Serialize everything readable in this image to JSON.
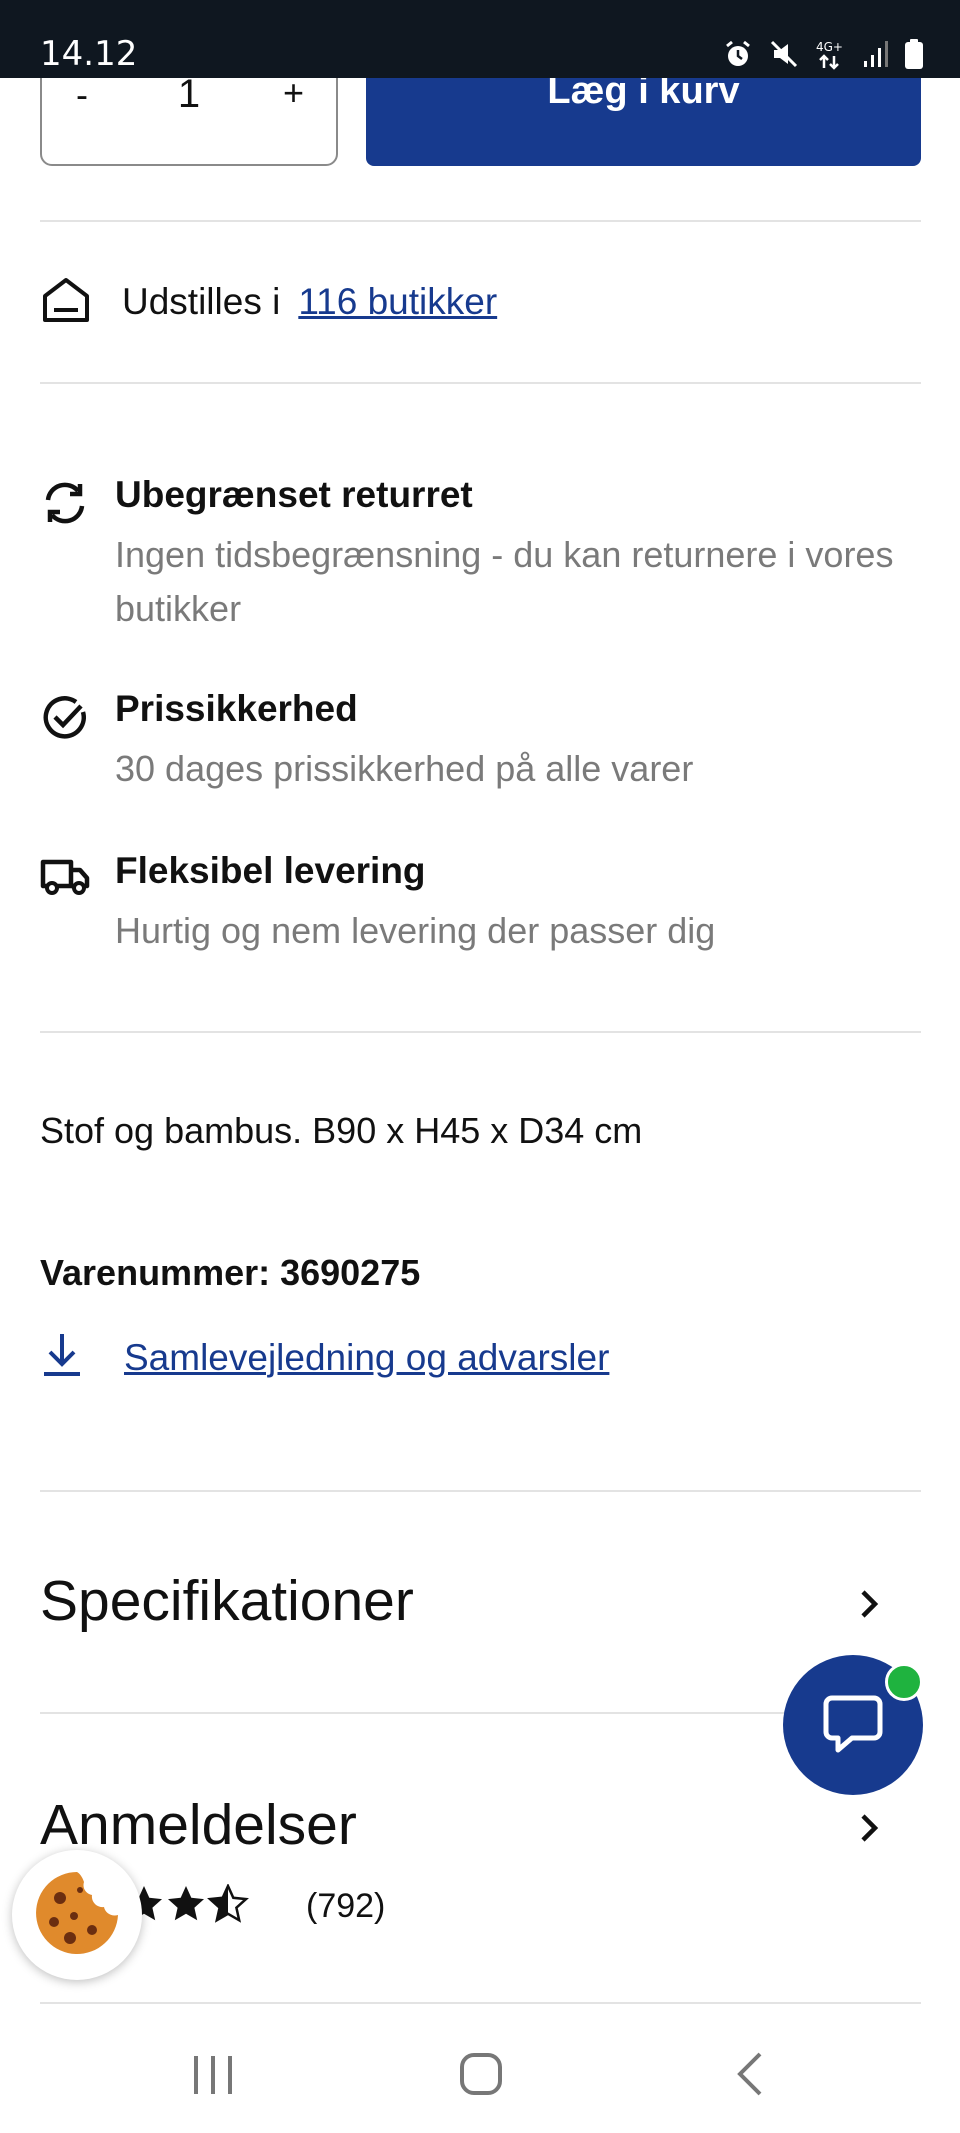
{
  "status_bar": {
    "time": "14.12",
    "network": "4G+",
    "icons": [
      "alarm-icon",
      "mute-icon",
      "network-4g-icon",
      "signal-icon",
      "battery-icon"
    ]
  },
  "purchase": {
    "minus_label": "-",
    "quantity": "1",
    "plus_label": "+",
    "add_to_cart_label": "Læg i kurv"
  },
  "showroom": {
    "text": "Udstilles i",
    "link": "116 butikker"
  },
  "benefits": [
    {
      "icon": "refresh-icon",
      "title": "Ubegrænset returret",
      "desc": "Ingen tidsbegrænsning - du kan returnere i vores butikker"
    },
    {
      "icon": "check-circle-icon",
      "title": "Prissikkerhed",
      "desc": "30 dages prissikkerhed på alle varer"
    },
    {
      "icon": "truck-icon",
      "title": "Fleksibel levering",
      "desc": "Hurtig og nem levering der passer dig"
    }
  ],
  "product": {
    "material": "Stof og bambus. B90 x H45 x D34 cm",
    "article_number": "Varenummer: 3690275",
    "download_link": "Samlevejledning og advarsler"
  },
  "sections": {
    "specifications": "Specifikationer",
    "reviews": "Anmeldelser",
    "review_count": "(792)",
    "rating": 4.5
  },
  "colors": {
    "brand_blue": "#173a8e",
    "status_bar": "#0f1720",
    "online_dot": "#1fb33f",
    "muted_text": "#7a7a7a"
  }
}
